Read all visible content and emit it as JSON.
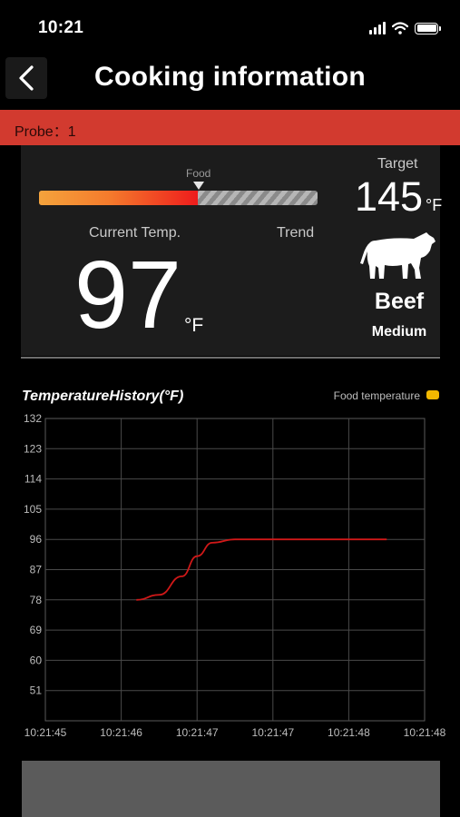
{
  "status_bar": {
    "time": "10:21"
  },
  "header": {
    "title": "Cooking information"
  },
  "probe": {
    "label": "Probe：1"
  },
  "current": {
    "food_label": "Food",
    "progress_fraction": 0.57,
    "label": "Current Temp.",
    "trend_label": "Trend",
    "value": "97",
    "unit": "°F"
  },
  "target": {
    "label": "Target",
    "value": "145",
    "unit": "°F",
    "icon": "cow-icon",
    "meat": "Beef",
    "doneness": "Medium"
  },
  "chart": {
    "title": "TemperatureHistory(°F)",
    "legend": "Food temperature"
  },
  "colors": {
    "accent_red": "#d23a2f",
    "line_red": "#d01818",
    "legend_yellow": "#f2b800"
  },
  "chart_data": {
    "type": "line",
    "title": "TemperatureHistory(°F)",
    "xlabel": "",
    "ylabel": "",
    "y_ticks": [
      51,
      60,
      69,
      78,
      87,
      96,
      105,
      114,
      123,
      132
    ],
    "ylim": [
      42,
      132
    ],
    "x_ticks": [
      "10:21:45",
      "10:21:46",
      "10:21:47",
      "10:21:47",
      "10:21:48",
      "10:21:48"
    ],
    "grid": true,
    "legend_position": "top-right",
    "series": [
      {
        "name": "Food temperature",
        "color": "#d01818",
        "x": [
          1.2,
          1.5,
          1.8,
          2.0,
          2.2,
          2.5,
          2.8,
          3.0,
          3.5,
          4.0,
          4.5
        ],
        "y": [
          78,
          79.5,
          85,
          91,
          95,
          96,
          96,
          96,
          96,
          96,
          96
        ]
      }
    ]
  }
}
